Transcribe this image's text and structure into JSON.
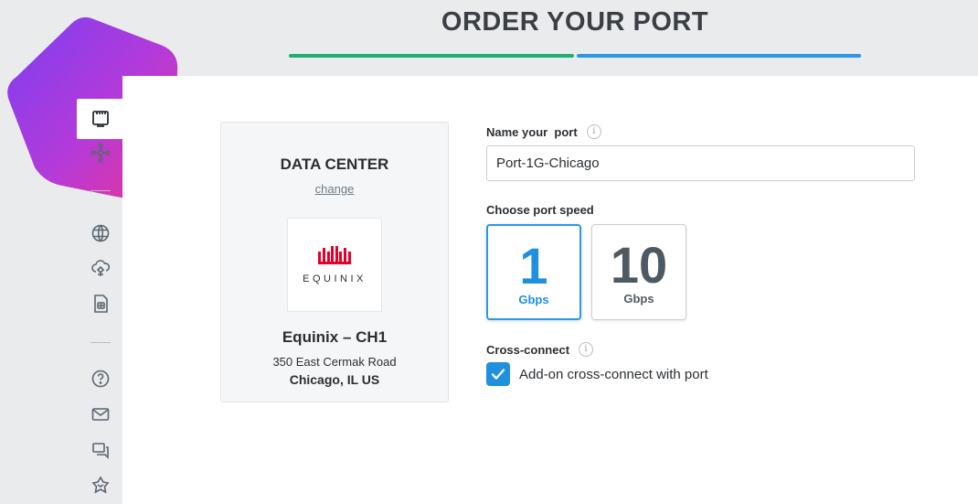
{
  "header": {
    "title": "ORDER YOUR PORT",
    "progress_steps": [
      "completed",
      "current"
    ],
    "progress_colors": [
      "#1fae7a",
      "#2a97e8"
    ]
  },
  "sidebar": {
    "items": [
      {
        "icon": "port-icon",
        "active": true
      },
      {
        "icon": "network-nodes-icon",
        "active": false
      },
      {
        "icon": "globe-icon",
        "active": false
      },
      {
        "icon": "cloud-connect-icon",
        "active": false
      },
      {
        "icon": "sim-card-icon",
        "active": false
      },
      {
        "icon": "help-icon",
        "active": false
      },
      {
        "icon": "mail-icon",
        "active": false
      },
      {
        "icon": "chat-icon",
        "active": false
      },
      {
        "icon": "partner-icon",
        "active": false
      }
    ]
  },
  "data_center": {
    "heading": "DATA CENTER",
    "change_link": "change",
    "logo_text": "EQUINIX",
    "logo_color": "#e4002b",
    "name": "Equinix – CH1",
    "address": "350 East Cermak Road",
    "city": "Chicago, IL US"
  },
  "form": {
    "name_label": "Name your  port",
    "name_value": "Port-1G-Chicago",
    "speed_label": "Choose port speed",
    "speeds": [
      {
        "value": "1",
        "unit": "Gbps",
        "selected": true
      },
      {
        "value": "10",
        "unit": "Gbps",
        "selected": false
      }
    ],
    "cross_connect_label": "Cross-connect",
    "cross_connect_checkbox_label": "Add-on cross-connect with port",
    "cross_connect_checked": true,
    "accent_color": "#1f8fe0"
  }
}
